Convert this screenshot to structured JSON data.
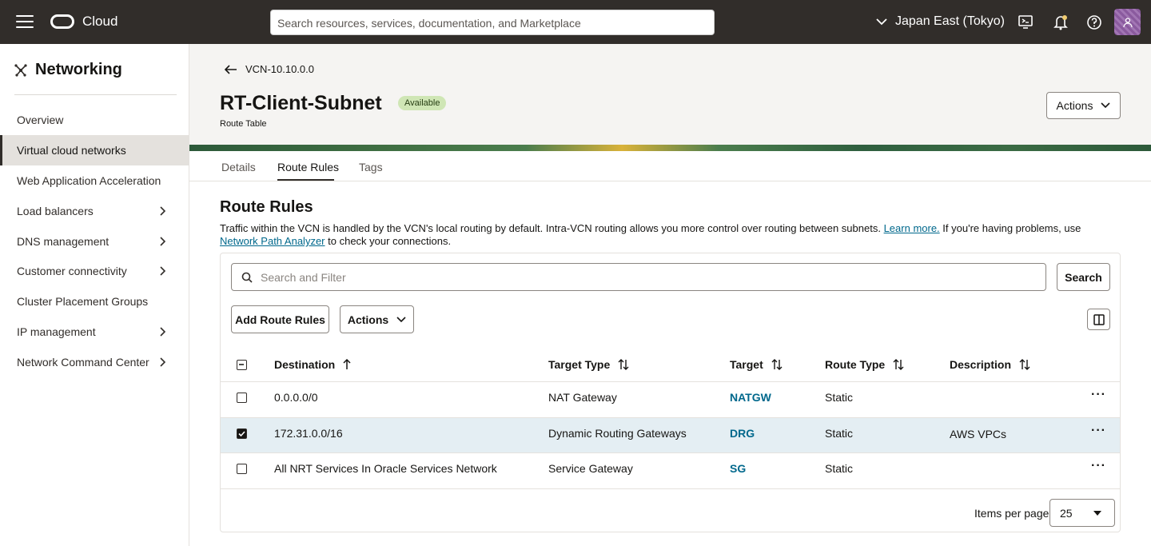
{
  "header": {
    "brand": "Cloud",
    "search_placeholder": "Search resources, services, documentation, and Marketplace",
    "region": "Japan East (Tokyo)",
    "icons": [
      "menu-icon",
      "cloud-shell-icon",
      "bell-icon",
      "help-icon",
      "user-icon"
    ]
  },
  "sidebar": {
    "title": "Networking",
    "items": [
      {
        "label": "Overview",
        "has_submenu": false
      },
      {
        "label": "Virtual cloud networks",
        "has_submenu": false,
        "active": true
      },
      {
        "label": "Web Application Acceleration",
        "has_submenu": false
      },
      {
        "label": "Load balancers",
        "has_submenu": true
      },
      {
        "label": "DNS management",
        "has_submenu": true
      },
      {
        "label": "Customer connectivity",
        "has_submenu": true
      },
      {
        "label": "Cluster Placement Groups",
        "has_submenu": false
      },
      {
        "label": "IP management",
        "has_submenu": true
      },
      {
        "label": "Network Command Center",
        "has_submenu": true
      }
    ]
  },
  "page": {
    "back_label": "VCN-10.10.0.0",
    "title": "RT-Client-Subnet",
    "status": "Available",
    "subtitle": "Route Table",
    "actions_label": "Actions"
  },
  "tabs": [
    {
      "label": "Details"
    },
    {
      "label": "Route Rules",
      "active": true
    },
    {
      "label": "Tags"
    }
  ],
  "section": {
    "title": "Route Rules",
    "desc_part1": "Traffic within the VCN is handled by the VCN's local routing by default. Intra-VCN routing allows you more control over routing between subnets.",
    "learn_more": "Learn more.",
    "desc_part2": "If you're having problems, use",
    "npa_link": "Network Path Analyzer",
    "desc_part3": "to check your connections."
  },
  "toolbar": {
    "filter_placeholder": "Search and Filter",
    "search_label": "Search",
    "add_label": "Add Route Rules",
    "actions_label": "Actions"
  },
  "table": {
    "columns": [
      "Destination",
      "Target Type",
      "Target",
      "Route Type",
      "Description"
    ],
    "rows": [
      {
        "destination": "0.0.0.0/0",
        "target_type": "NAT Gateway",
        "target": "NATGW",
        "route_type": "Static",
        "description": "",
        "checked": false
      },
      {
        "destination": "172.31.0.0/16",
        "target_type": "Dynamic Routing Gateways",
        "target": "DRG",
        "route_type": "Static",
        "description": "AWS VPCs",
        "checked": true
      },
      {
        "destination": "All NRT Services In Oracle Services Network",
        "target_type": "Service Gateway",
        "target": "SG",
        "route_type": "Static",
        "description": "",
        "checked": false
      }
    ],
    "more_label": "···"
  },
  "pagination": {
    "items_per_page_label": "Items per page",
    "items_per_page": "25"
  }
}
